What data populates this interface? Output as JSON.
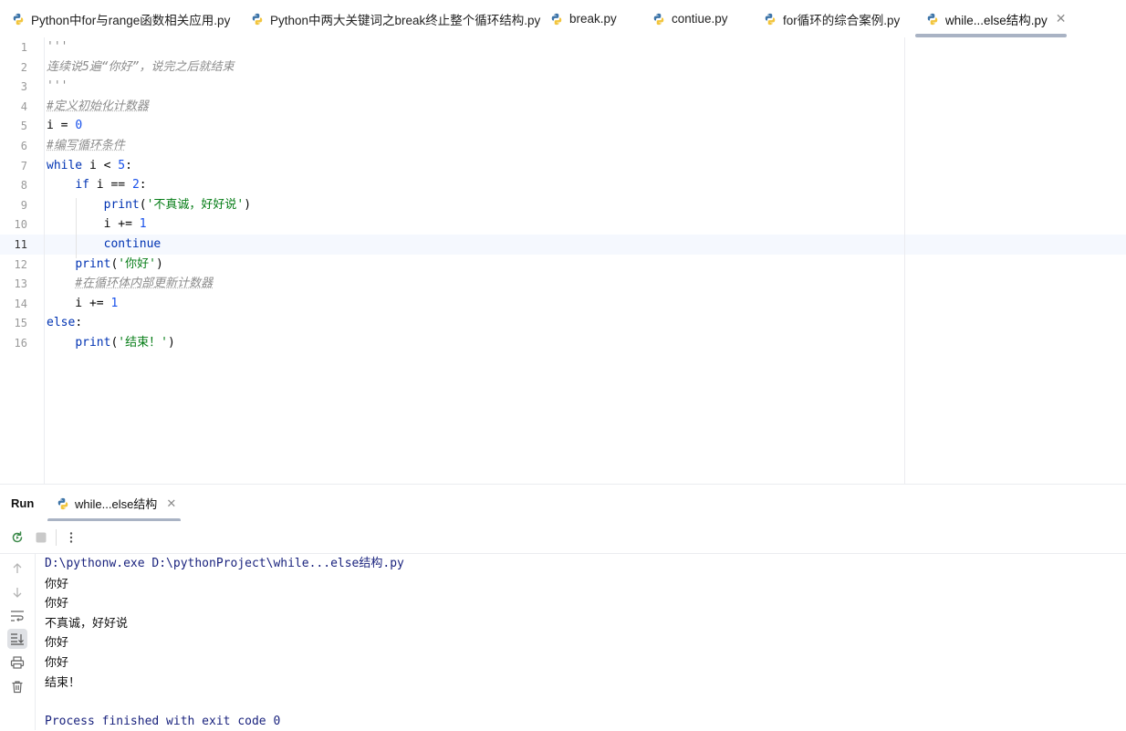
{
  "tabs": [
    {
      "label": "Python中for与range函数相关应用.py"
    },
    {
      "label": "Python中两大关键词之break终止整个循环结构.py"
    },
    {
      "label": "break.py"
    },
    {
      "label": "contiue.py"
    },
    {
      "label": "for循环的综合案例.py"
    },
    {
      "label": "while...else结构.py",
      "active": true
    }
  ],
  "editor": {
    "current_line": 11,
    "lines": [
      {
        "n": "1",
        "tokens": [
          {
            "t": "'''",
            "c": "doc"
          }
        ]
      },
      {
        "n": "2",
        "tokens": [
          {
            "t": "连续说5遍“你好”，说完之后就结束",
            "c": "doc"
          }
        ]
      },
      {
        "n": "3",
        "tokens": [
          {
            "t": "'''",
            "c": "doc"
          }
        ]
      },
      {
        "n": "4",
        "tokens": [
          {
            "t": "#定义初始化计数器",
            "c": "cmt"
          }
        ]
      },
      {
        "n": "5",
        "tokens": [
          {
            "t": "i = ",
            "c": ""
          },
          {
            "t": "0",
            "c": "num"
          }
        ]
      },
      {
        "n": "6",
        "tokens": [
          {
            "t": "#编写循环条件",
            "c": "cmt"
          }
        ]
      },
      {
        "n": "7",
        "tokens": [
          {
            "t": "while",
            "c": "kw"
          },
          {
            "t": " i < ",
            "c": ""
          },
          {
            "t": "5",
            "c": "num"
          },
          {
            "t": ":",
            "c": ""
          }
        ]
      },
      {
        "n": "8",
        "tokens": [
          {
            "t": "    ",
            "c": ""
          },
          {
            "t": "if",
            "c": "kw"
          },
          {
            "t": " i == ",
            "c": ""
          },
          {
            "t": "2",
            "c": "num"
          },
          {
            "t": ":",
            "c": ""
          }
        ]
      },
      {
        "n": "9",
        "tokens": [
          {
            "t": "        ",
            "c": ""
          },
          {
            "t": "print",
            "c": "kw"
          },
          {
            "t": "(",
            "c": ""
          },
          {
            "t": "'不真诚，好好说'",
            "c": "str"
          },
          {
            "t": ")",
            "c": ""
          }
        ]
      },
      {
        "n": "10",
        "tokens": [
          {
            "t": "        i += ",
            "c": ""
          },
          {
            "t": "1",
            "c": "num"
          }
        ]
      },
      {
        "n": "11",
        "tokens": [
          {
            "t": "        ",
            "c": ""
          },
          {
            "t": "continue",
            "c": "kw"
          }
        ]
      },
      {
        "n": "12",
        "tokens": [
          {
            "t": "    ",
            "c": ""
          },
          {
            "t": "print",
            "c": "kw"
          },
          {
            "t": "(",
            "c": ""
          },
          {
            "t": "'你好'",
            "c": "str"
          },
          {
            "t": ")",
            "c": ""
          }
        ]
      },
      {
        "n": "13",
        "tokens": [
          {
            "t": "    ",
            "c": ""
          },
          {
            "t": "#在循环体内部更新计数器",
            "c": "cmt"
          }
        ]
      },
      {
        "n": "14",
        "tokens": [
          {
            "t": "    i += ",
            "c": ""
          },
          {
            "t": "1",
            "c": "num"
          }
        ]
      },
      {
        "n": "15",
        "tokens": [
          {
            "t": "else",
            "c": "kw"
          },
          {
            "t": ":",
            "c": ""
          }
        ]
      },
      {
        "n": "16",
        "tokens": [
          {
            "t": "    ",
            "c": ""
          },
          {
            "t": "print",
            "c": "kw"
          },
          {
            "t": "(",
            "c": ""
          },
          {
            "t": "'结束！'",
            "c": "str"
          },
          {
            "t": ")",
            "c": ""
          }
        ]
      }
    ]
  },
  "run": {
    "title": "Run",
    "tab_label": "while...else结构",
    "console": {
      "command": "D:\\pythonw.exe D:\\pythonProject\\while...else结构.py",
      "output": [
        "你好",
        "你好",
        "不真诚，好好说",
        "你好",
        "你好",
        "结束！"
      ],
      "finished": "Process finished with exit code 0"
    }
  },
  "colors": {
    "keyword": "#0033b3",
    "number": "#1750eb",
    "string": "#067d17",
    "comment": "#8c8c8c",
    "current_line": "#f5f8fe",
    "console_text": "#1a237e"
  },
  "icons": {
    "file": "python-file-icon",
    "rerun": "rerun-icon",
    "stop": "stop-icon",
    "more": "more-vertical-icon",
    "side": [
      "scroll-up-icon",
      "scroll-down-icon",
      "soft-wrap-icon",
      "scroll-to-end-icon",
      "print-icon",
      "trash-icon"
    ]
  }
}
